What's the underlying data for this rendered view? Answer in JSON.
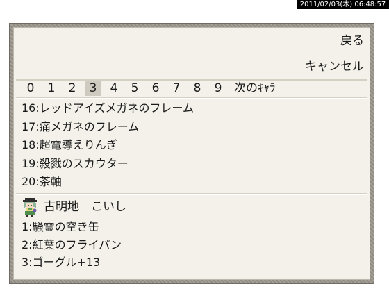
{
  "timestamp": "2011/02/03(木) 06:48:57",
  "menu": {
    "back_label": "戻る",
    "cancel_label": "キャンセル"
  },
  "char_tabs": {
    "digits": [
      "0",
      "1",
      "2",
      "3",
      "4",
      "5",
      "6",
      "7",
      "8",
      "9"
    ],
    "selected_index": 3,
    "next_label": "次のｷｬﾗ"
  },
  "items": [
    "16:レッドアイズメガネのフレーム",
    "17:痛メガネのフレーム",
    "18:超電導えりんぎ",
    "19:殺戮のスカウター",
    "20:茶軸"
  ],
  "character": {
    "name": "古明地　こいし",
    "sprite": "koishi-sprite-icon"
  },
  "equipment": [
    "1:騒霊の空き缶",
    "2:紅葉のフライパン",
    "3:ゴーグル+13"
  ],
  "colors": {
    "panel_bg": "#f3f1ea",
    "frame": "#9b968c",
    "selected_tab": "#cfcabf",
    "text": "#1a1a1a"
  }
}
